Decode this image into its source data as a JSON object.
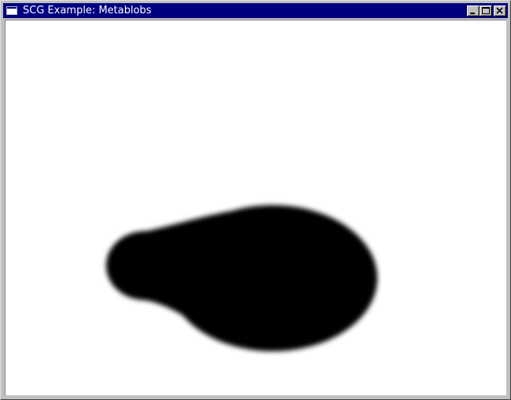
{
  "window": {
    "title": "SCG Example: Metablobs",
    "icon": "window-app-icon",
    "title_bar_color": "#000080",
    "controls": {
      "minimize": "minimize-icon",
      "maximize": "maximize-icon",
      "close": "close-icon"
    }
  },
  "canvas": {
    "background": "#ffffff",
    "blob_color": "#000000"
  }
}
